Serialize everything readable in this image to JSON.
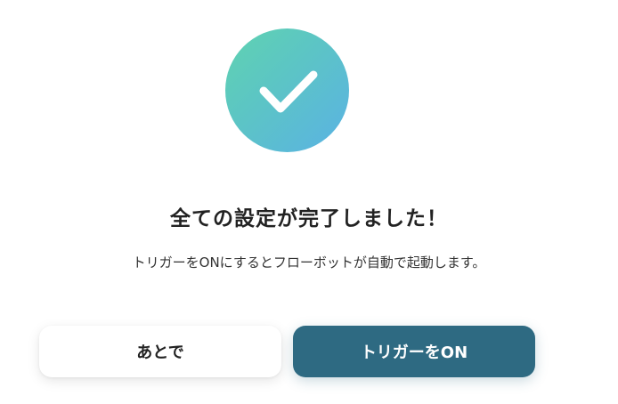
{
  "dialog": {
    "icon": "check-circle-icon",
    "title": "全ての設定が完了しました！",
    "message": "トリガーをONにするとフローボットが自動で起動します。",
    "buttons": {
      "later_label": "あとで",
      "on_label": "トリガーをON"
    }
  },
  "colors": {
    "badge_gradient_start": "#5fd3b0",
    "badge_gradient_end": "#5ab2e4",
    "primary_button": "#2e6a82",
    "secondary_button": "#ffffff",
    "title_text": "#222222"
  }
}
